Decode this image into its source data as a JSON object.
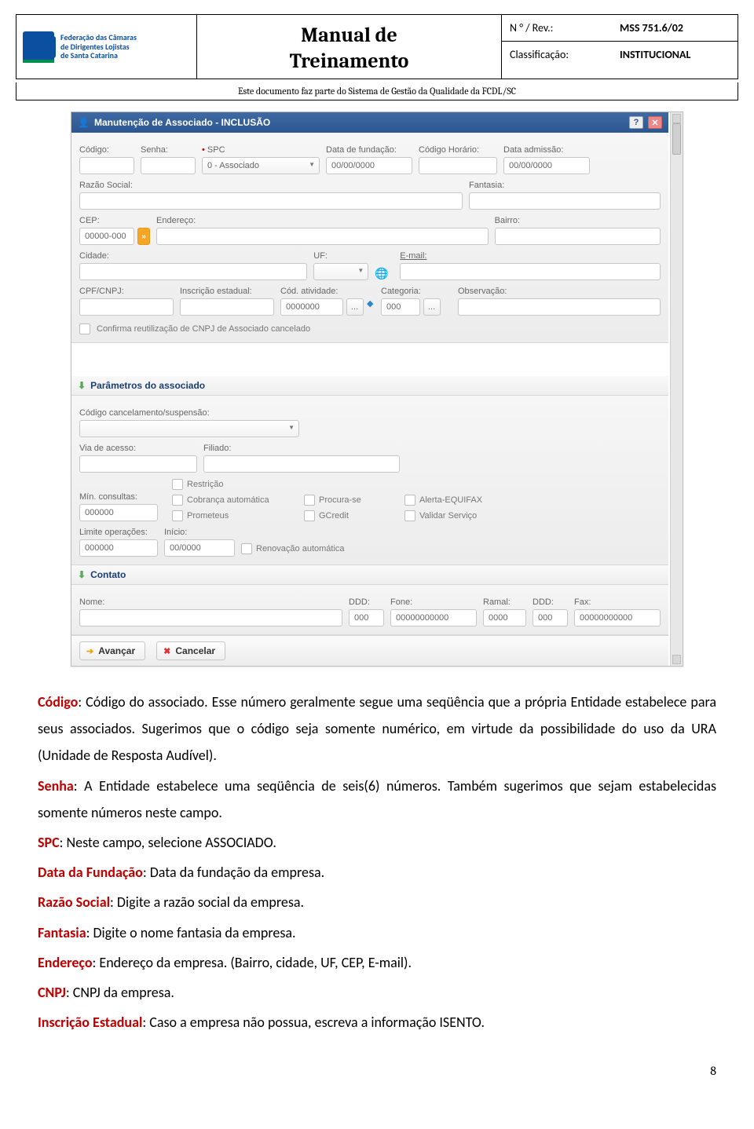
{
  "header": {
    "logo_line1": "Federação das Câmaras",
    "logo_line2": "de Dirigentes Lojistas",
    "logo_line3": "de Santa Catarina",
    "title_line1": "Manual de",
    "title_line2": "Treinamento",
    "rev_label": "N ° / Rev.:",
    "rev_value": "MSS 751.6/02",
    "class_label": "Classificação:",
    "class_value": "INSTITUCIONAL",
    "subtitle": "Este documento faz parte do Sistema de Gestão da Qualidade da FCDL/SC"
  },
  "modal": {
    "title": "Manutenção de Associado - INCLUSÃO",
    "labels": {
      "codigo": "Código:",
      "senha": "Senha:",
      "spc": "SPC",
      "data_fund": "Data de fundação:",
      "cod_horario": "Código Horário:",
      "data_admissao": "Data admissão:",
      "razao": "Razão Social:",
      "fantasia": "Fantasia:",
      "cep": "CEP:",
      "endereco": "Endereço:",
      "bairro": "Bairro:",
      "cidade": "Cidade:",
      "uf": "UF:",
      "email": "E-mail:",
      "cpfcnpj": "CPF/CNPJ:",
      "insc_est": "Inscrição estadual:",
      "cod_ativ": "Cód. atividade:",
      "categoria": "Categoria:",
      "observacao": "Observação:",
      "confirma": "Confirma reutilização de CNPJ de Associado cancelado"
    },
    "values": {
      "spc_select": "0 - Associado",
      "date_mask": "00/00/0000",
      "cep_mask": "00000-000",
      "cod_ativ_mask": "0000000",
      "cat_mask": "000"
    },
    "params": {
      "title": "Parâmetros do associado",
      "cod_cancel": "Código cancelamento/suspensão:",
      "via_acesso": "Via de acesso:",
      "filiado": "Filiado:",
      "min_consultas": "Mín. consultas:",
      "limite_op": "Limite operações:",
      "inicio": "Início:",
      "chk_restricao": "Restrição",
      "chk_cobranca": "Cobrança automática",
      "chk_procura": "Procura-se",
      "chk_alerta": "Alerta-EQUIFAX",
      "chk_prometeus": "Prometeus",
      "chk_gcredit": "GCredit",
      "chk_validar": "Validar Serviço",
      "chk_renov": "Renovação automática",
      "num6": "000000",
      "date7": "00/0000"
    },
    "contato": {
      "title": "Contato",
      "nome": "Nome:",
      "ddd": "DDD:",
      "fone": "Fone:",
      "ramal": "Ramal:",
      "fax": "Fax:",
      "ddd_mask": "000",
      "fone_mask": "00000000000",
      "ramal_mask": "0000"
    },
    "buttons": {
      "avancar": "Avançar",
      "cancelar": "Cancelar"
    }
  },
  "body": {
    "codigo_k": "Código",
    "codigo_t": ": Código do associado. Esse número geralmente segue uma seqüência que a própria Entidade estabelece para seus associados. Sugerimos que o código seja somente numérico, em virtude da possibilidade do uso da URA (Unidade de Resposta Audível).",
    "senha_k": "Senha",
    "senha_t": ": A Entidade estabelece uma seqüência de seis(6) números. Também sugerimos que sejam estabelecidas somente números neste campo.",
    "spc_k": "SPC",
    "spc_t": ": Neste campo, selecione ASSOCIADO.",
    "datafund_k": "Data da Fundação",
    "datafund_t": ": Data da fundação da empresa.",
    "razao_k": "Razão Social",
    "razao_t": ": Digite a razão social da empresa.",
    "fantasia_k": "Fantasia",
    "fantasia_t": ": Digite o nome fantasia da empresa.",
    "endereco_k": "Endereço",
    "endereco_t": ": Endereço da empresa. (Bairro, cidade, UF, CEP, E-mail).",
    "cnpj_k": "CNPJ",
    "cnpj_t": ": CNPJ da empresa.",
    "insc_k": "Inscrição Estadual",
    "insc_t": ": Caso a empresa não possua, escreva a informação ISENTO."
  },
  "page_number": "8"
}
